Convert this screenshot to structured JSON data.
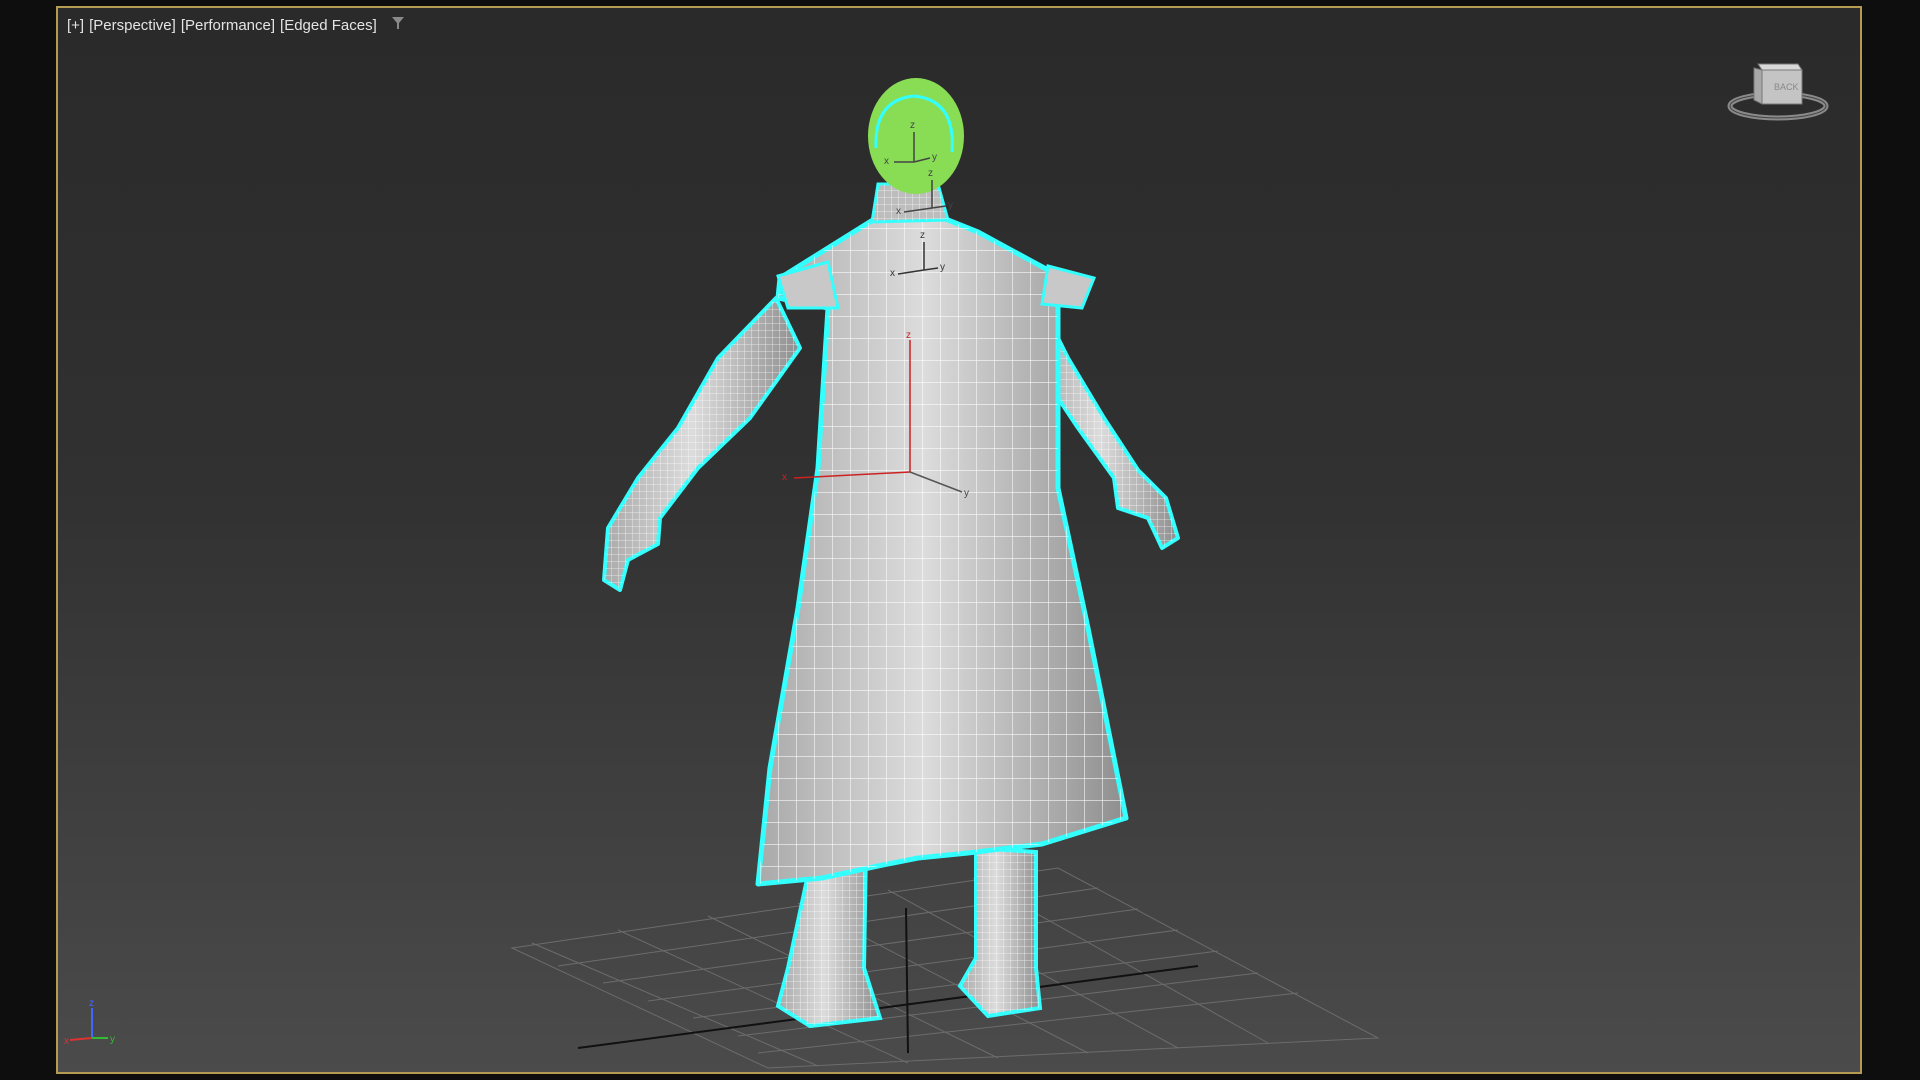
{
  "viewport": {
    "labels": {
      "plus": "[+]",
      "view": "[Perspective]",
      "mode": "[Performance]",
      "shading": "[Edged Faces]"
    },
    "filter_icon": "filter-funnel-icon",
    "viewcube_face": "BACK",
    "frame_color": "#b59a52",
    "selection_color": "#33ffff",
    "head_color": "#88dd55"
  },
  "gizmos": {
    "head": {
      "z": "z",
      "x": "x",
      "y": "y"
    },
    "neck": {
      "z": "z",
      "x": "x",
      "y": "y"
    },
    "chest": {
      "z": "z",
      "x": "x",
      "y": "y"
    },
    "pivot": {
      "x": "x",
      "y": "y",
      "z": "z"
    }
  },
  "axis_tripod": {
    "z": "z",
    "x": "x",
    "y": "y"
  }
}
